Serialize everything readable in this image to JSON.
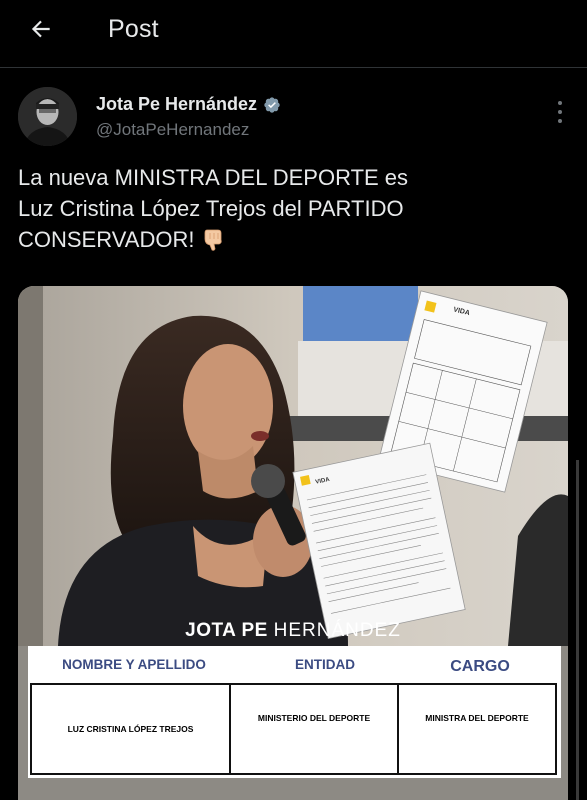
{
  "header": {
    "title": "Post"
  },
  "post": {
    "author_name": "Jota Pe Hernández",
    "handle": "@JotaPeHernandez",
    "text_line1": "La nueva MINISTRA DEL DEPORTE es",
    "text_line2": "Luz Cristina López Trejos del PARTIDO",
    "text_line3": "CONSERVADOR!"
  },
  "media": {
    "watermark_bold": "JOTA PE",
    "watermark_thin": "HERNÁNDEZ",
    "doc_brand_1": "VIDA",
    "doc_brand_2": "VIDA",
    "table": {
      "headers": [
        "NOMBRE Y APELLIDO",
        "ENTIDAD",
        "CARGO"
      ],
      "row": [
        "LUZ CRISTINA LÓPEZ TREJOS",
        "MINISTERIO DEL DEPORTE",
        "MINISTRA DEL DEPORTE"
      ]
    }
  },
  "icons": {
    "back": "arrow-left-icon",
    "verified": "verified-badge-icon",
    "more": "more-vertical-icon",
    "emoji": "backhand-index-pointing-down-icon"
  },
  "colors": {
    "background": "#000000",
    "text": "#e7e9ea",
    "secondary": "#71767b",
    "verified": "#829aab",
    "table_header": "#3b4b82"
  }
}
